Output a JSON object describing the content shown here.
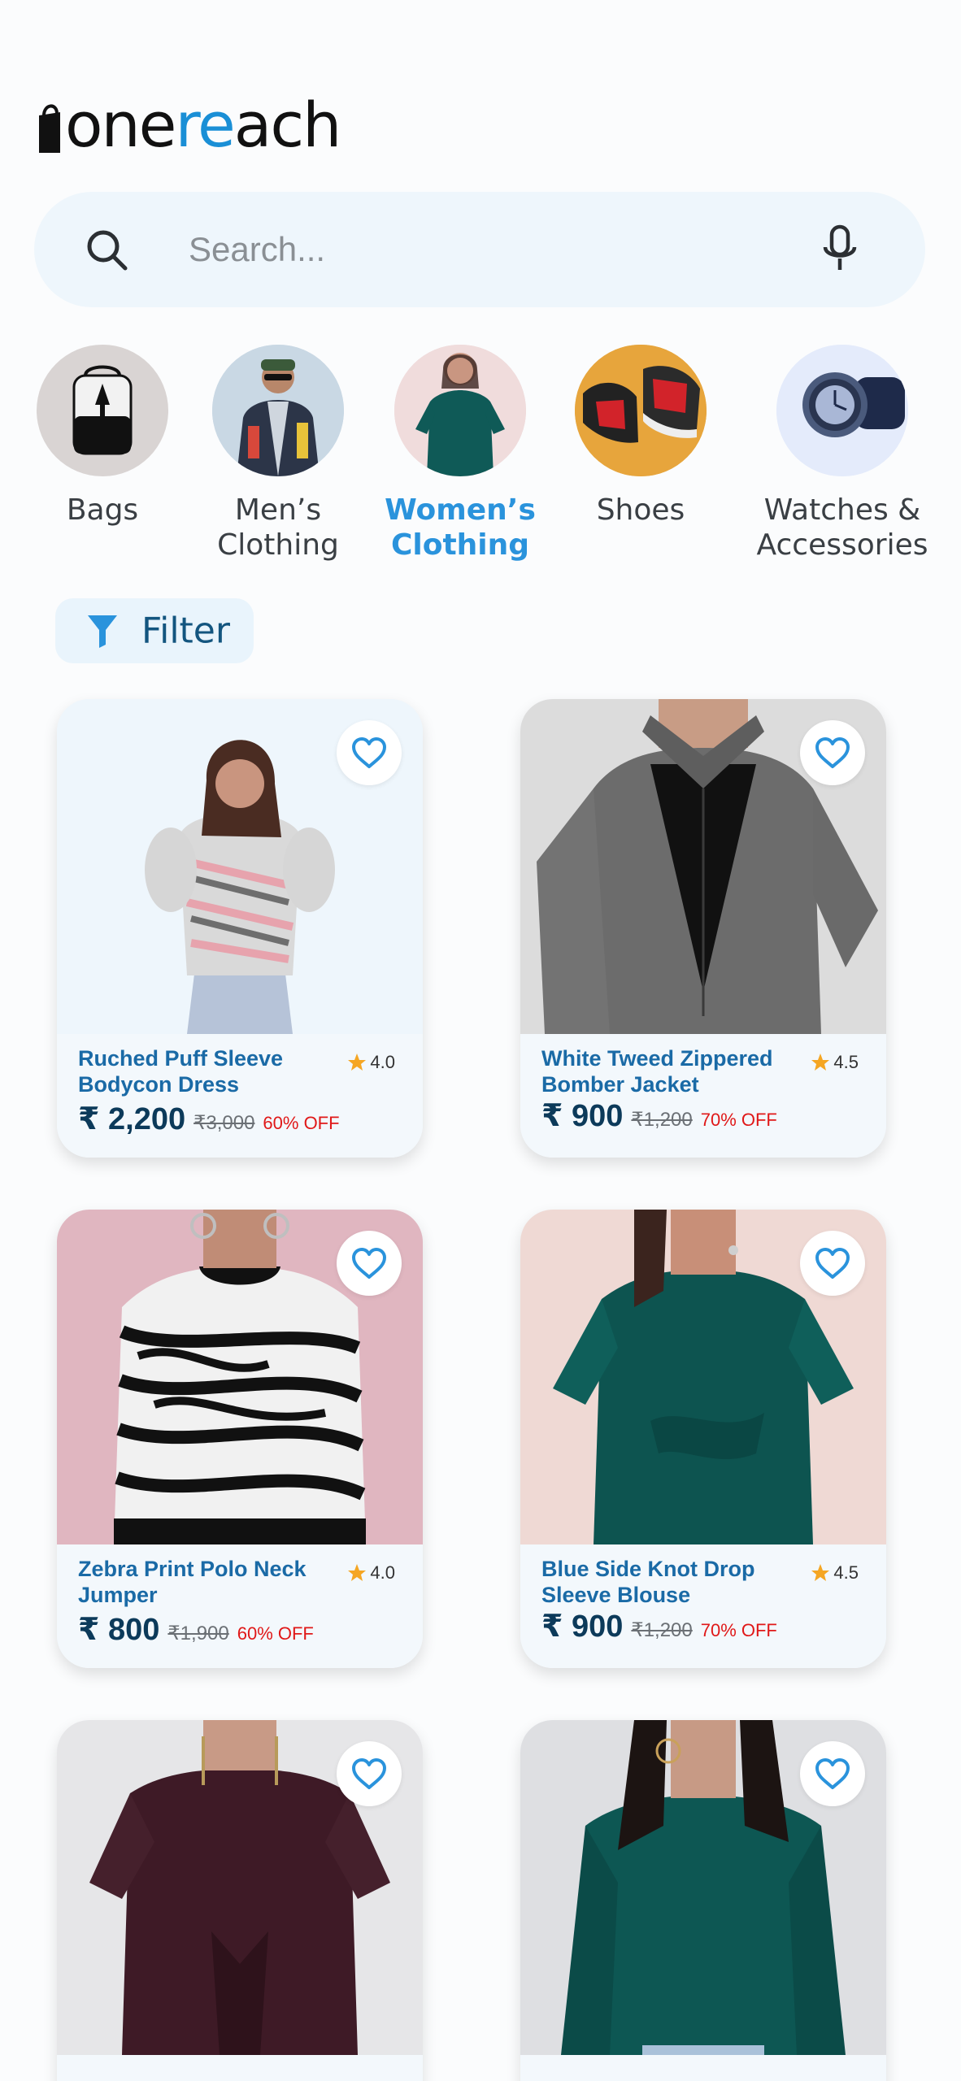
{
  "app": {
    "logo": {
      "part1": "on",
      "part2": "e",
      "part3": "re",
      "part4": "ach",
      "full": "onereach"
    }
  },
  "search": {
    "placeholder": "Search..."
  },
  "categories": [
    {
      "label": "Bags",
      "active": false
    },
    {
      "label": "Men’s Clothing",
      "line1": "Men’s",
      "line2": "Clothing",
      "active": false
    },
    {
      "label": "Women’s Clothing",
      "line1": "Women’s",
      "line2": "Clothing",
      "active": true
    },
    {
      "label": "Shoes",
      "active": false
    },
    {
      "label": "Watches & Accessories",
      "line1": "Watches &",
      "line2": "Accessories",
      "active": false
    }
  ],
  "filter": {
    "label": "Filter"
  },
  "products": [
    {
      "name": "Ruched Puff Sleeve Bodycon Dress",
      "rating": "4.0",
      "price": "₹ 2,200",
      "old_price": "₹3,000",
      "discount": "60% OFF"
    },
    {
      "name": "White Tweed Zippered Bomber Jacket",
      "rating": "4.5",
      "price": "₹ 900",
      "old_price": "₹1,200",
      "discount": "70% OFF"
    },
    {
      "name": "Zebra Print Polo Neck Jumper",
      "rating": "4.0",
      "price": "₹ 800",
      "old_price": "₹1,900",
      "discount": "60% OFF"
    },
    {
      "name": "Blue Side Knot Drop Sleeve Blouse",
      "rating": "4.5",
      "price": "₹ 900",
      "old_price": "₹1,200",
      "discount": "70% OFF"
    },
    {
      "name": "",
      "rating": "",
      "price": "",
      "old_price": "",
      "discount": ""
    },
    {
      "name": "",
      "rating": "",
      "price": "",
      "old_price": "",
      "discount": ""
    }
  ],
  "colors": {
    "accent": "#2a93dc",
    "price": "#0c3a5a",
    "discount": "#e01818",
    "star": "#f5a623",
    "heart": "#2a93dc"
  },
  "icons": {
    "search": "search-icon",
    "mic": "microphone-icon",
    "filter": "funnel-icon",
    "favorite": "heart-outline-icon",
    "rating": "star-icon"
  }
}
